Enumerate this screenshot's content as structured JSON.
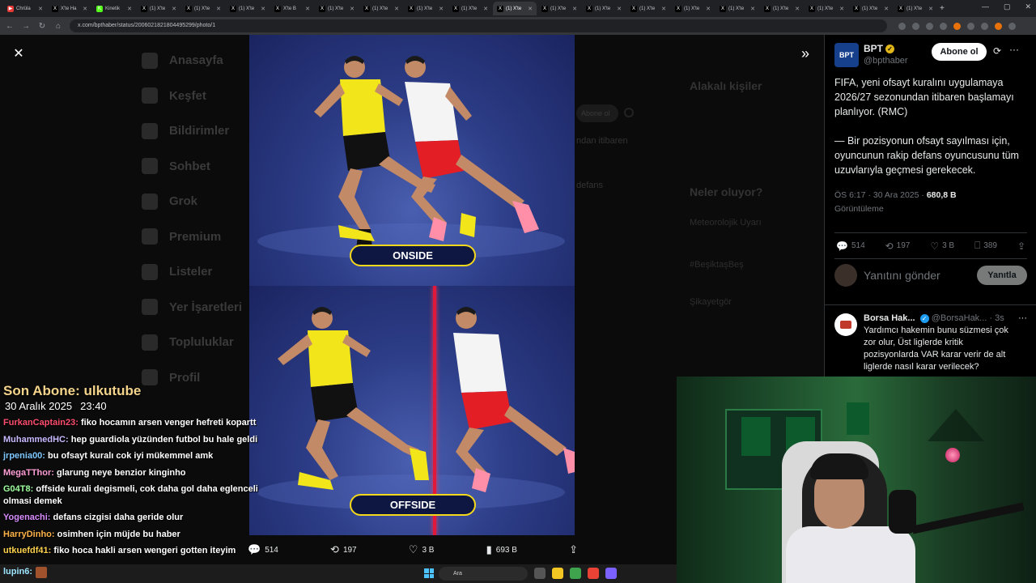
{
  "browser": {
    "tabs": [
      {
        "label": "Chrüla",
        "fav": "▶",
        "color": "#e53935"
      },
      {
        "label": "X'te Ha",
        "fav": "X",
        "color": "#000"
      },
      {
        "label": "Kinetik",
        "fav": "K",
        "color": "#53fc18"
      },
      {
        "label": "(1) X'te",
        "fav": "X",
        "color": "#000"
      },
      {
        "label": "(1) X'te",
        "fav": "X",
        "color": "#000"
      },
      {
        "label": "(1) X'te",
        "fav": "X",
        "color": "#000"
      },
      {
        "label": "X'te B",
        "fav": "X",
        "color": "#000"
      },
      {
        "label": "(1) X'te",
        "fav": "X",
        "color": "#000"
      },
      {
        "label": "(1) X'te",
        "fav": "X",
        "color": "#000"
      },
      {
        "label": "(1) X'te",
        "fav": "X",
        "color": "#000"
      },
      {
        "label": "(1) X'te",
        "fav": "X",
        "color": "#000"
      },
      {
        "label": "(1) X'te",
        "fav": "X",
        "color": "#000",
        "active": true
      },
      {
        "label": "(1) X'te",
        "fav": "X",
        "color": "#000"
      },
      {
        "label": "(1) X'te",
        "fav": "X",
        "color": "#000"
      },
      {
        "label": "(1) X'te",
        "fav": "X",
        "color": "#000"
      },
      {
        "label": "(1) X'te",
        "fav": "X",
        "color": "#000"
      },
      {
        "label": "(1) X'te",
        "fav": "X",
        "color": "#000"
      },
      {
        "label": "(1) X'te",
        "fav": "X",
        "color": "#000"
      },
      {
        "label": "(1) X'te",
        "fav": "X",
        "color": "#000"
      },
      {
        "label": "(1) X'te",
        "fav": "X",
        "color": "#000"
      },
      {
        "label": "(1) X'te",
        "fav": "X",
        "color": "#000"
      }
    ],
    "url": "x.com/bpthaber/status/2006021821804495299/photo/1"
  },
  "background": {
    "sidebar": [
      "Anasayfa",
      "Keşfet",
      "Bildirimler",
      "Sohbet",
      "Grok",
      "Premium",
      "Listeler",
      "Yer İşaretleri",
      "Topluluklar",
      "Profil"
    ],
    "right_heading_1": "Alakalı kişiler",
    "right_heading_2": "Neler oluyor?",
    "right_items": [
      "Meteorolojik Uyarı",
      "#BeşiktaşBeş",
      "Şikayetgör"
    ],
    "mid_text_1": "ndan itibaren",
    "mid_text_2": "defans"
  },
  "photo": {
    "top_label": "ONSIDE",
    "bottom_label": "OFFSIDE",
    "actions": {
      "replies": "514",
      "reposts": "197",
      "likes": "3 B",
      "views": "693 B"
    }
  },
  "tweet": {
    "name": "BPT",
    "handle": "@bpthaber",
    "follow_label": "Abone ol",
    "text": "FIFA, yeni ofsayt kuralını uygulamaya 2026/27 sezonundan itibaren başlamayı planlıyor. (RMC)\n\n— Bir pozisyonun ofsayt sayılması için, oyuncunun rakip defans oyuncusunu tüm uzuvlarıyla geçmesi gerekecek.",
    "time": "ÖS 6:17 · 30 Ara 2025 · ",
    "views_count": "680,8 B",
    "views_label": "Görüntüleme",
    "stats": {
      "replies": "514",
      "reposts": "197",
      "likes": "3 B",
      "bookmarks": "389"
    },
    "reply_placeholder": "Yanıtını gönder",
    "reply_button": "Yanıtla"
  },
  "reply": {
    "name": "Borsa Hak...",
    "handle": "@BorsaHak...",
    "time": "· 3s",
    "text": "Yardımcı hakemin bunu süzmesi çok zor olur, Üst liglerde kritik pozisyonlarda VAR karar verir de alt liglerde nasıl karar verilecek?"
  },
  "overlay": {
    "sub_title": "Son Abone: ulkutube",
    "date": "30 Aralık 2025",
    "time": "23:40"
  },
  "chat": [
    {
      "user": "FurkanCaptain23:",
      "color": "#ff4d6d",
      "msg": "fiko hocamın arsen venger hefreti kopartt"
    },
    {
      "user": "MuhammedHC:",
      "color": "#c8b9ff",
      "msg": "hep guardiola yüzünden futbol bu hale geldi"
    },
    {
      "user": "jrpenia00:",
      "color": "#7fc8ff",
      "msg": "bu ofsayt kuralı cok iyi mükemmel amk"
    },
    {
      "user": "MegaTThor:",
      "color": "#ff9ed6",
      "msg": "glarung neye benzior kinginho"
    },
    {
      "user": "G04T8:",
      "color": "#a0ffa0",
      "msg": "offside kurali degismeli, cok daha gol daha eglenceli olmasi demek"
    },
    {
      "user": "Yogenachi:",
      "color": "#d98cff",
      "msg": "defans cizgisi daha geride olur"
    },
    {
      "user": "HarryDinho:",
      "color": "#ffb347",
      "msg": "osimhen için müjde bu haber"
    },
    {
      "user": "utkuefdf41:",
      "color": "#ffd24d",
      "msg": "fiko hoca hakli arsen wengeri gotten iteyim"
    }
  ],
  "taskbar": {
    "user": "lupin6:",
    "search_label": "Ara"
  }
}
